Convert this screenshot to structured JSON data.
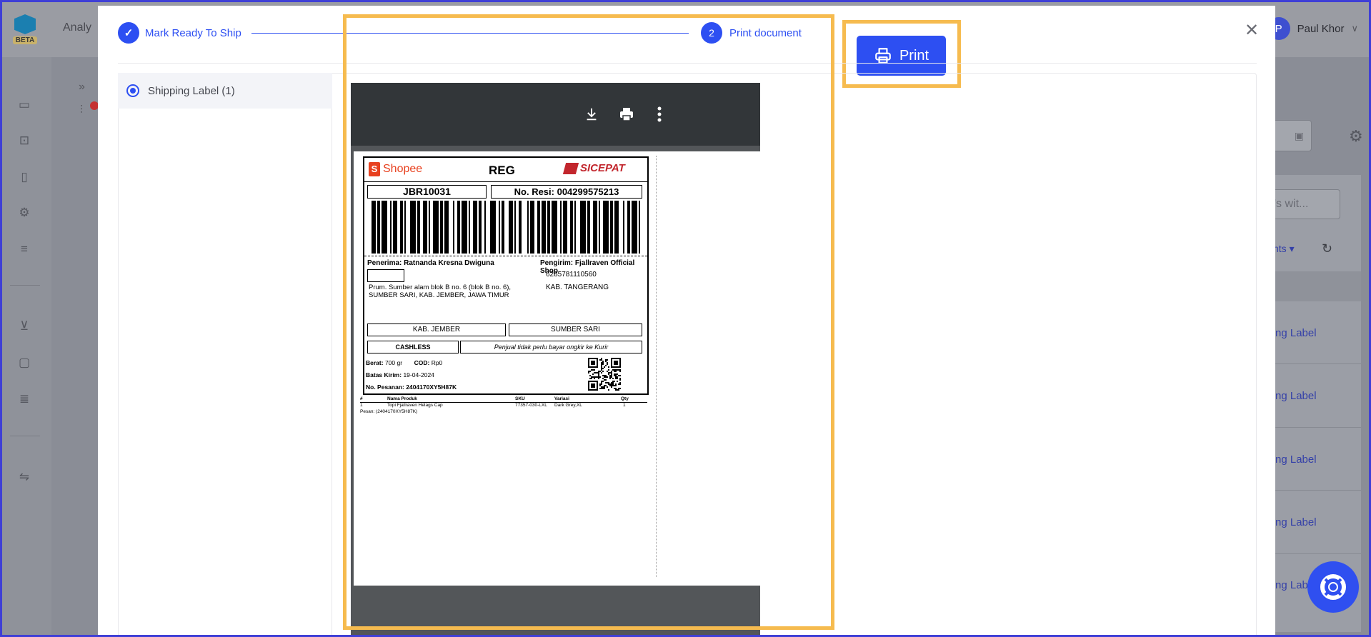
{
  "app": {
    "logo_badge": "BETA",
    "title_fragment": "Analy",
    "user_initial": "P",
    "user_name": "Paul Khor",
    "user_chevron": "∨"
  },
  "background": {
    "search_placeholder_fragment": "'s wit...",
    "filter_fragment": "nts ▾",
    "row_links": [
      "ng Label",
      "ng Label",
      "ng Label",
      "ng Label",
      "ng Labe"
    ]
  },
  "stepper": {
    "step1_label": "Mark Ready To Ship",
    "step2_number": "2",
    "step2_label": "Print document"
  },
  "actions": {
    "print_label": "Print",
    "close_glyph": "✕"
  },
  "documents": [
    {
      "label": "Shipping Label (1)",
      "selected": true
    }
  ],
  "label": {
    "marketplace": "Shopee",
    "service": "REG",
    "courier": "SICEPAT",
    "code": "JBR10031",
    "resi": "No. Resi: 004299575213",
    "receiver_line": "Penerima: Ratnanda Kresna Dwiguna",
    "sender_line": "Pengirim:  Fjallraven Official Shop",
    "sender_phone": "6285781110560",
    "address": "Prum. Sumber alam blok B no. 6 (blok B no. 6), SUMBER SARI, KAB. JEMBER, JAWA TIMUR",
    "sender_city": "KAB. TANGERANG",
    "dest_city": "KAB. JEMBER",
    "dest_district": "SUMBER SARI",
    "payment": "CASHLESS",
    "payment_note": "Penjual tidak perlu bayar ongkir ke Kurir",
    "weight_label": "Berat:",
    "weight": "700 gr",
    "cod_label": "COD:",
    "cod": "Rp0",
    "deadline_label": "Batas Kirim:",
    "deadline": "19-04-2024",
    "order_label": "No. Pesanan:",
    "order_no": "2404170XY5H87K",
    "items_header": {
      "no": "#",
      "name": "Nama Produk",
      "sku": "SKU",
      "variant": "Variasi",
      "qty": "Qty"
    },
    "items": [
      {
        "no": "1",
        "name": "Topi Fjallraven Helags Cap",
        "sku": "77357-030-LXL",
        "variant": "Dark Grey,XL",
        "qty": "1"
      }
    ],
    "pesan": "Pesan: (2404170XY5H87K)"
  },
  "colors": {
    "accent": "#2d4ff2",
    "highlight": "#f6bb4f",
    "viewer_bar": "#323639"
  }
}
